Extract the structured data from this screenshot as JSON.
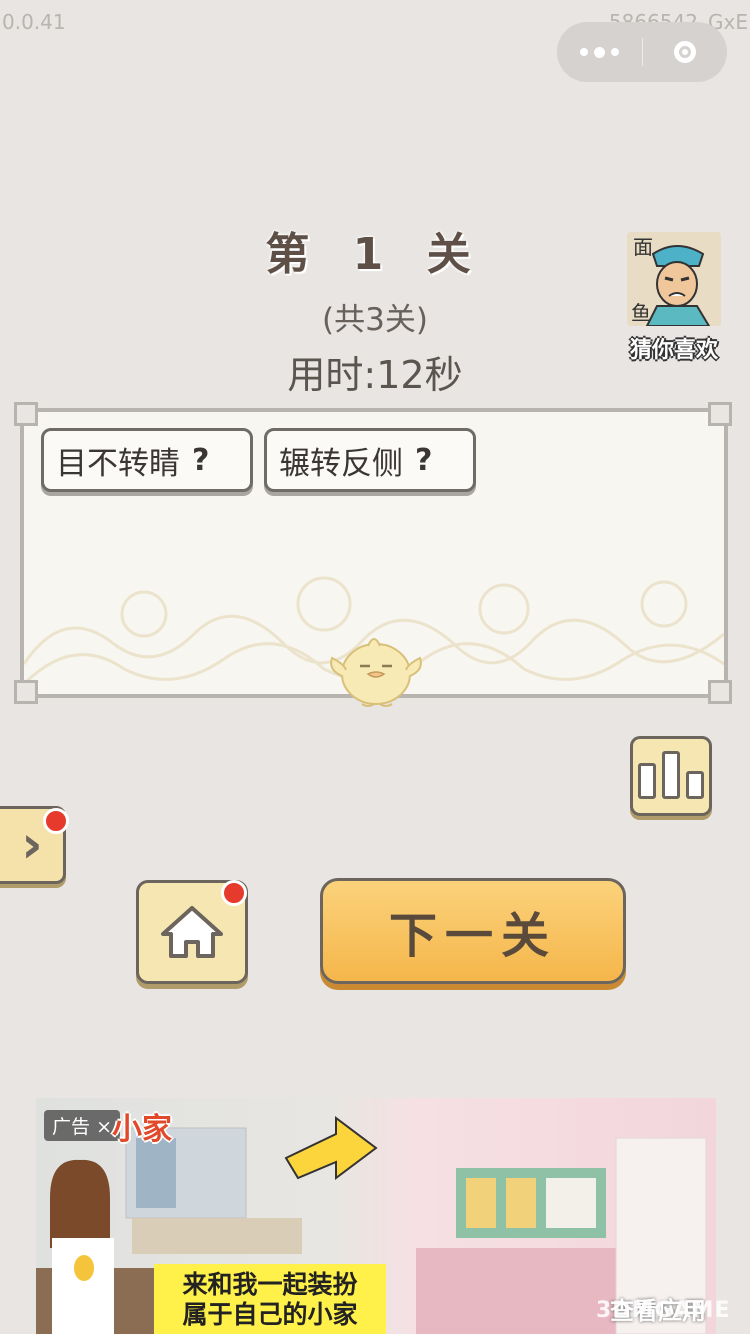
{
  "status": {
    "version": "0.0.41",
    "build": "5866542_GxE"
  },
  "level": {
    "title": "第 1 关",
    "total": "(共3关)",
    "time": "用时:12秒"
  },
  "recommend": {
    "label": "猜你喜欢",
    "icon": "game-thumbnail-icon"
  },
  "answers": [
    {
      "text": "目不转睛",
      "hint": "?"
    },
    {
      "text": "辗转反侧",
      "hint": "?"
    }
  ],
  "buttons": {
    "next": "下一关",
    "home_icon": "home-icon",
    "rank_icon": "bar-chart-icon",
    "side_icon": "chevron-right-icon"
  },
  "ad": {
    "tag": "广告",
    "close": "×",
    "logo": "小家",
    "caption_line1": "来和我一起装扮",
    "caption_line2": "属于自己的小家",
    "cta": "查看应用"
  },
  "watermark": "3DMGAME",
  "colors": {
    "background": "#e8e5e2",
    "next_button": "#f5b64b",
    "badge": "#e53a2c",
    "button_fill": "#f6e7b2"
  }
}
